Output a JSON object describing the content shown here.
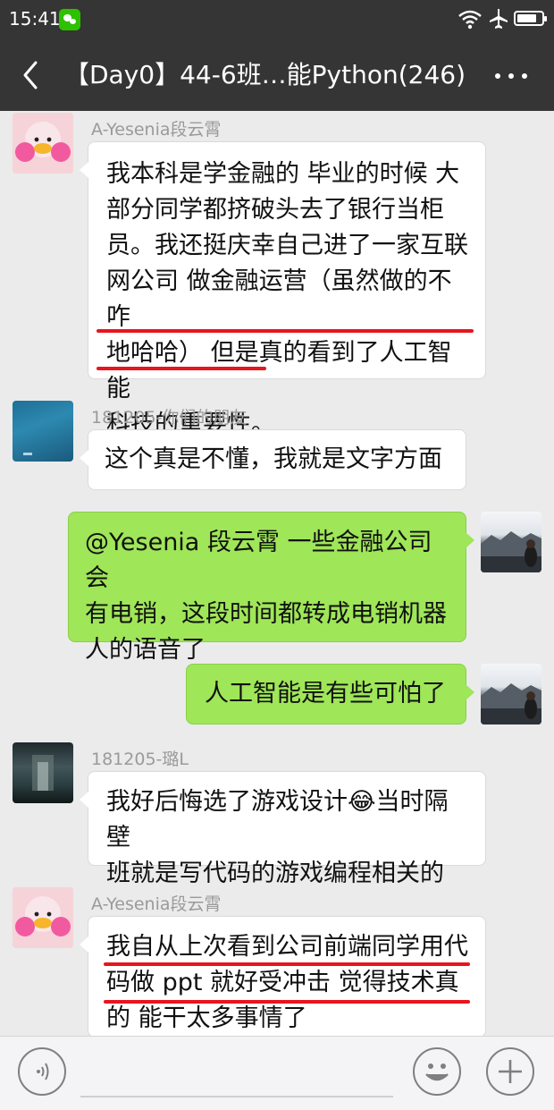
{
  "status_bar": {
    "time": "15:41"
  },
  "header": {
    "title": "【Day0】44-6班…能Python(246)"
  },
  "messages": [
    {
      "side": "left",
      "sender": "A-Yesenia段云霄",
      "lines": [
        "我本科是学金融的 毕业的时候 大",
        "部分同学都挤破头去了银行当柜",
        "员。我还挺庆幸自己进了一家互联",
        "网公司 做金融运营（虽然做的不咋",
        "地哈哈） 但是真的看到了人工智能",
        "科技的重要性。"
      ]
    },
    {
      "side": "left",
      "sender": "181205-你们的朋友",
      "lines": [
        "这个真是不懂，我就是文字方面"
      ]
    },
    {
      "side": "right",
      "lines": [
        "@Yesenia 段云霄 一些金融公司会",
        "有电销，这段时间都转成电销机器",
        "人的语音了"
      ]
    },
    {
      "side": "right",
      "lines": [
        "人工智能是有些可怕了"
      ]
    },
    {
      "side": "left",
      "sender": "181205-璐L",
      "lines": [
        "我好后悔选了游戏设计😂当时隔壁",
        "班就是写代码的游戏编程相关的"
      ]
    },
    {
      "side": "left",
      "sender": "A-Yesenia段云霄",
      "lines": [
        "我自从上次看到公司前端同学用代",
        "码做 ppt 就好受冲击 觉得技术真",
        "的 能干太多事情了"
      ]
    }
  ],
  "colors": {
    "bar_bg": "#353535",
    "chat_bg": "#ebebeb",
    "bubble_self": "#9fe658",
    "bubble_other": "#ffffff",
    "highlight_underline": "#e8141e"
  },
  "icons": {
    "back": "chevron-left-icon",
    "more": "more-dots-icon",
    "voice": "voice-icon",
    "emoji": "emoji-icon",
    "add": "plus-icon"
  }
}
